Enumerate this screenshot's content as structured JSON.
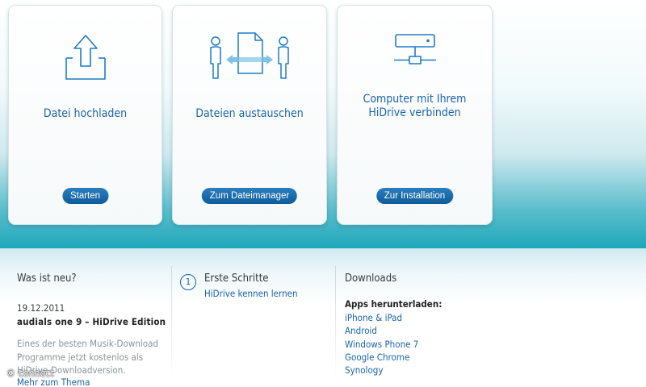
{
  "cards": [
    {
      "title_lines": [
        "Datei hochladen"
      ],
      "button": "Starten",
      "icon": "upload-icon"
    },
    {
      "title_lines": [
        "Dateien austauschen"
      ],
      "button": "Zum Dateimanager",
      "icon": "file-exchange-icon"
    },
    {
      "title_lines": [
        "Computer mit Ihrem",
        "HiDrive verbinden"
      ],
      "button": "Zur Installation",
      "icon": "network-drive-icon"
    }
  ],
  "news": {
    "heading": "Was ist neu?",
    "date": "19.12.2011",
    "headline": "audials one 9 – HiDrive Edition",
    "text_lines": [
      "Eines der besten Musik-Download",
      "Programme jetzt kostenlos als",
      "HiDrive-Downloadversion."
    ],
    "more_link": "Mehr zum Thema"
  },
  "steps": {
    "number": "1",
    "heading": "Erste Schritte",
    "link": "HiDrive kennen lernen"
  },
  "downloads": {
    "heading": "Downloads",
    "subheading": "Apps herunterladen:",
    "items": [
      "iPhone & iPad",
      "Android",
      "Windows Phone 7",
      "Google Chrome",
      "Synology"
    ]
  },
  "watermark": "© connect",
  "colors": {
    "accent": "#1b64a8",
    "button": "#0f5b98",
    "band": "#1ea7ba"
  }
}
